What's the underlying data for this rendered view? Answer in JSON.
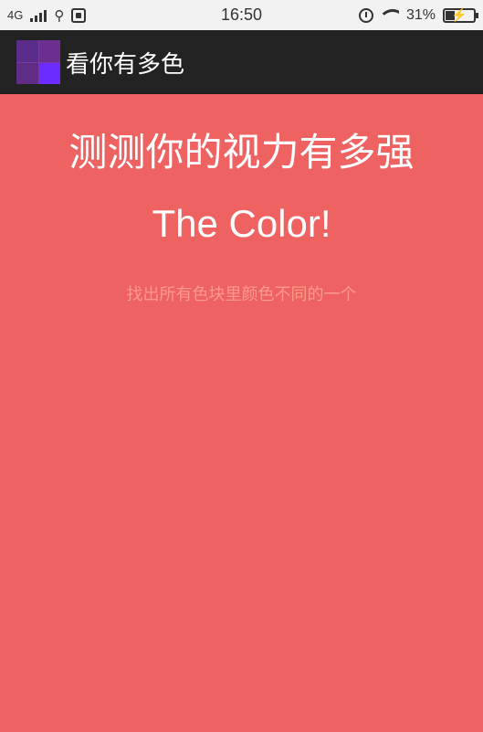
{
  "status_bar": {
    "network": "4G",
    "time": "16:50",
    "battery_percent": "31%",
    "battery_level": 0.31,
    "icons": [
      "signal-icon",
      "usb-icon",
      "app-notification-icon",
      "alarm-icon",
      "wifi-icon",
      "battery-icon"
    ]
  },
  "app_bar": {
    "title": "看你有多色",
    "logo_colors": [
      "#5a2d8a",
      "#6a2f8f",
      "#5f2c86",
      "#6b2cff"
    ]
  },
  "main": {
    "headline": "测测你的视力有多强",
    "subtitle": "The Color!",
    "hint": "找出所有色块里颜色不同的一个",
    "background": "#ef6262",
    "hint_color": "#ff9a8c"
  }
}
